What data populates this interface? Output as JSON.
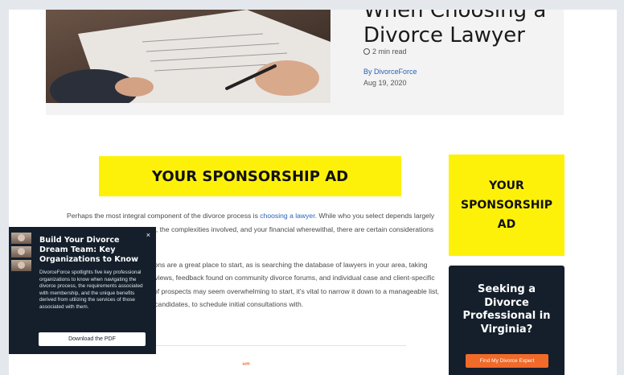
{
  "article": {
    "title_line_top": "When Choosing a",
    "title_line_main": "Divorce Lawyer",
    "read_time": "2 min read",
    "author": "By DivorceForce",
    "date": "Aug 19, 2020",
    "body": {
      "p1_before_link": "Perhaps the most integral component of the divorce process is ",
      "p1_link": "choosing a lawyer",
      "p1_after_link": ". While who you select depends largely upon your individual situation, the complexities involved, and your financial wherewithal, there are certain considerations across the board.",
      "p2": "Referrals and recommendations are a great place to start, as is searching the database of lawyers in your area, taking into consideration of client reviews, feedback found on community divorce forums, and individual case and client-specific experiences. While the pool of prospects may seem overwhelming to start, it's vital to narrow it down to a manageable list, ideally, about three potential candidates, to schedule initial consultations with."
    },
    "quote_mark": "“”"
  },
  "ads": {
    "main_ad": "YOUR SPONSORSHIP AD",
    "side_ad": "YOUR SPONSORSHIP AD"
  },
  "cta": {
    "heading": "Seeking a Divorce Professional in Virginia?",
    "button": "Find My Divorce Expert"
  },
  "popup": {
    "close": "×",
    "title": "Build Your Divorce Dream Team: Key Organizations to Know",
    "body": "DivorceForce spotlights five key professional organizations to know when navigating the divorce process, the requirements associated with membership, and the unique benefits derived from utilizing the services of those associated with them.",
    "button": "Download the PDF"
  },
  "colors": {
    "ad_yellow": "#fdf10a",
    "navy": "#141f2b",
    "accent_orange": "#f06a2a",
    "link_blue": "#2a62b8"
  },
  "icons": [
    "clock-icon",
    "close-icon"
  ]
}
